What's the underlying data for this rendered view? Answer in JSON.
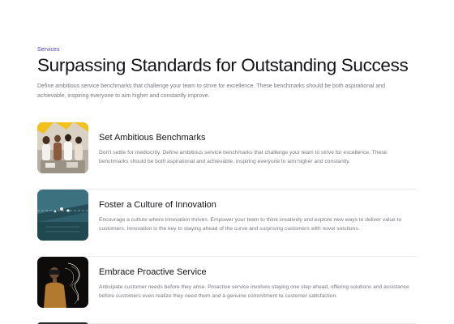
{
  "header": {
    "eyebrow": "Services",
    "title": "Surpassing Standards for Outstanding Success",
    "intro": "Define ambitious service benchmarks that challenge your team to strive for excellence. These benchmarks should be both aspirational and achievable, inspiring everyone to aim higher and constantly improve."
  },
  "services": [
    {
      "title": "Set Ambitious Benchmarks",
      "description": "Don't settle for mediocrity. Define ambitious service benchmarks that challenge your team to strive for excellence. These benchmarks should be both aspirational and achievable, inspiring everyone to aim higher and constantly."
    },
    {
      "title": "Foster a Culture of Innovation",
      "description": "Encourage a culture where innovation thrives. Empower your team to think creatively and explore new ways to deliver value to customers. Innovation is the key to staying ahead of the curve and surprising customers with novel solutions."
    },
    {
      "title": "Embrace Proactive Service",
      "description": "Anticipate customer needs before they arise. Proactive service involves staying one step ahead, offering solutions and assistance before customers even realize they need them and a genuine commitment to customer satisfaction."
    }
  ],
  "colors": {
    "accent": "#4b3fd1",
    "heading": "#141418",
    "muted": "#7a7a82",
    "divider": "#ececef"
  }
}
